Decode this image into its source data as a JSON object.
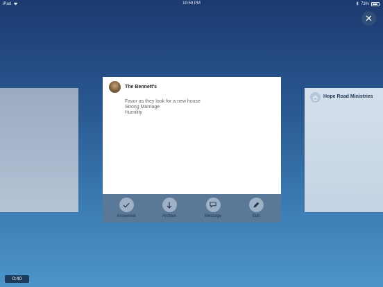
{
  "status_bar": {
    "carrier": "iPad",
    "time": "10:59 PM",
    "battery": "73%"
  },
  "right_card": {
    "title": "Hope Road Ministries"
  },
  "main_card": {
    "title": "The Bennett's",
    "requests": [
      "Favor as they look for a new house",
      "Strong Marriage",
      "Humility"
    ]
  },
  "actions": {
    "answered": "Answered",
    "archive": "Archive",
    "message": "Message",
    "edit": "Edit"
  },
  "close_symbol": "✕",
  "timer": "0:40",
  "icons": [
    "wifi-icon",
    "bluetooth-icon",
    "battery-icon",
    "close-icon",
    "lock-icon",
    "avatar",
    "check-icon",
    "arrow-down-icon",
    "message-icon",
    "pencil-icon"
  ]
}
